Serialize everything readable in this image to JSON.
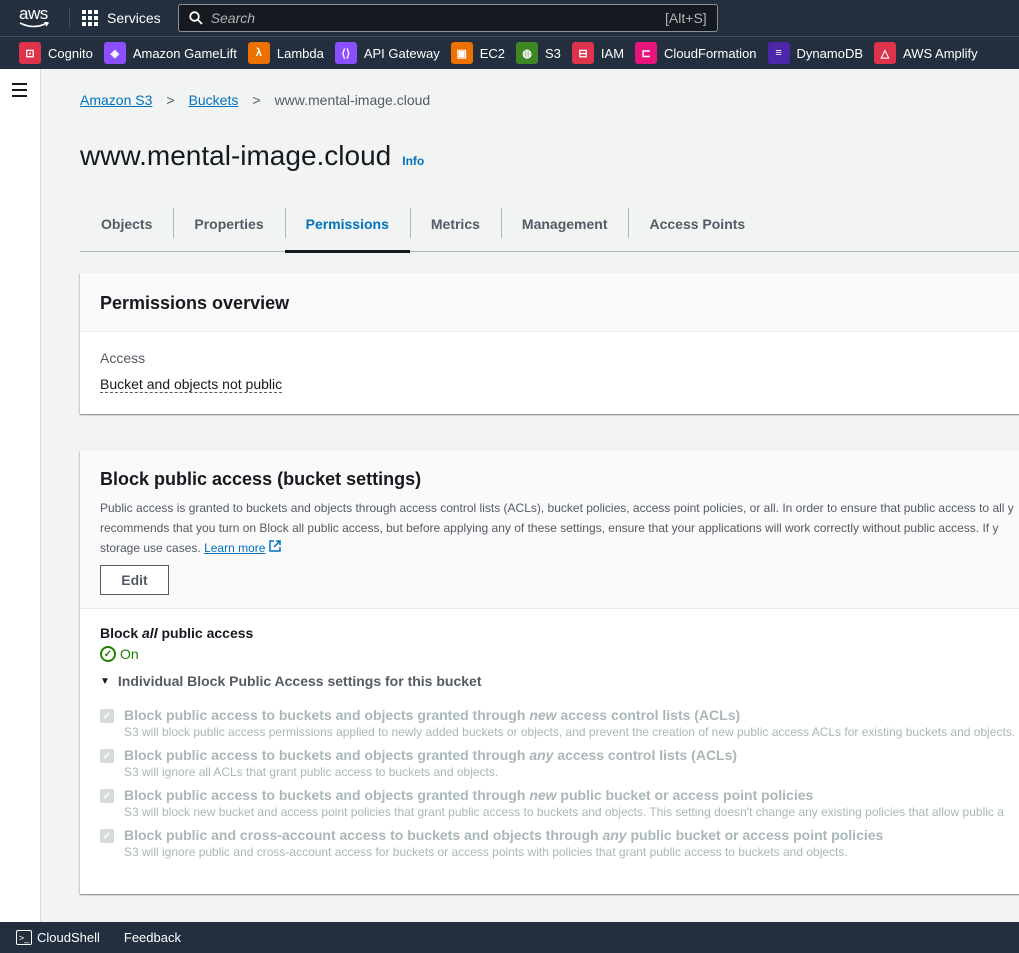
{
  "topbar": {
    "logo_text": "aws",
    "services_label": "Services",
    "search_placeholder": "Search",
    "search_shortcut": "[Alt+S]"
  },
  "favorites": [
    {
      "label": "Cognito",
      "color": "#dd344c",
      "icon": "cognito-icon"
    },
    {
      "label": "Amazon GameLift",
      "color": "#8c4fff",
      "icon": "gamelift-icon"
    },
    {
      "label": "Lambda",
      "color": "#ed7100",
      "icon": "lambda-icon"
    },
    {
      "label": "API Gateway",
      "color": "#8c4fff",
      "icon": "api-gateway-icon"
    },
    {
      "label": "EC2",
      "color": "#ed7100",
      "icon": "ec2-icon"
    },
    {
      "label": "S3",
      "color": "#3f8624",
      "icon": "s3-icon"
    },
    {
      "label": "IAM",
      "color": "#dd344c",
      "icon": "iam-icon"
    },
    {
      "label": "CloudFormation",
      "color": "#e7157b",
      "icon": "cloudformation-icon"
    },
    {
      "label": "DynamoDB",
      "color": "#4d27aa",
      "icon": "dynamodb-icon"
    },
    {
      "label": "AWS Amplify",
      "color": "#dd344c",
      "icon": "amplify-icon"
    }
  ],
  "breadcrumb": {
    "items": [
      "Amazon S3",
      "Buckets"
    ],
    "current": "www.mental-image.cloud"
  },
  "page": {
    "title": "www.mental-image.cloud",
    "info": "Info"
  },
  "tabs": [
    {
      "label": "Objects",
      "active": false
    },
    {
      "label": "Properties",
      "active": false
    },
    {
      "label": "Permissions",
      "active": true
    },
    {
      "label": "Metrics",
      "active": false
    },
    {
      "label": "Management",
      "active": false
    },
    {
      "label": "Access Points",
      "active": false
    }
  ],
  "overview": {
    "heading": "Permissions overview",
    "access_label": "Access",
    "access_value": "Bucket and objects not public"
  },
  "block": {
    "heading": "Block public access (bucket settings)",
    "desc_line1": "Public access is granted to buckets and objects through access control lists (ACLs), bucket policies, access point policies, or all. In order to ensure that public access to all y",
    "desc_line2": "recommends that you turn on Block all public access, but before applying any of these settings, ensure that your applications will work correctly without public access. If y",
    "desc_line3": "storage use cases.",
    "learn_more": "Learn more",
    "edit": "Edit",
    "all_label_pre": "Block ",
    "all_label_em": "all",
    "all_label_post": " public access",
    "status": "On",
    "individual": "Individual Block Public Access settings for this bucket",
    "settings": [
      {
        "pre": "Block public access to buckets and objects granted through ",
        "em": "new",
        "post": " access control lists (ACLs)",
        "desc": "S3 will block public access permissions applied to newly added buckets or objects, and prevent the creation of new public access ACLs for existing buckets and objects."
      },
      {
        "pre": "Block public access to buckets and objects granted through ",
        "em": "any",
        "post": " access control lists (ACLs)",
        "desc": "S3 will ignore all ACLs that grant public access to buckets and objects."
      },
      {
        "pre": "Block public access to buckets and objects granted through ",
        "em": "new",
        "post": " public bucket or access point policies",
        "desc": "S3 will block new bucket and access point policies that grant public access to buckets and objects. This setting doesn't change any existing policies that allow public a"
      },
      {
        "pre": "Block public and cross-account access to buckets and objects through ",
        "em": "any",
        "post": " public bucket or access point policies",
        "desc": "S3 will ignore public and cross-account access for buckets or access points with policies that grant public access to buckets and objects."
      }
    ]
  },
  "footer": {
    "cloudshell": "CloudShell",
    "feedback": "Feedback"
  }
}
